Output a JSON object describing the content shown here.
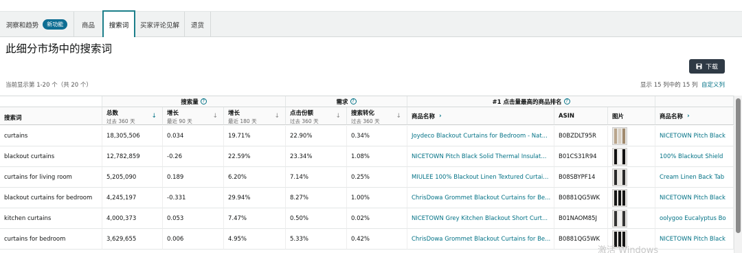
{
  "tabs": [
    {
      "label": "洞察和趋势",
      "badge": "新功能"
    },
    {
      "label": "商品"
    },
    {
      "label": "搜索词"
    },
    {
      "label": "买家评论见解"
    },
    {
      "label": "退货"
    }
  ],
  "page_title": "此细分市场中的搜索词",
  "download_label": "下载",
  "showing_text": "当前显示第 1-20 个（共 20 个）",
  "columns_status": "显示 15 列中的 15 列",
  "customize_label": "自定义列",
  "groups": {
    "search_volume": "搜索量",
    "demand": "需求",
    "top_product": "#1 点击量最高的商品排名"
  },
  "headers": {
    "term": "搜索词",
    "total": {
      "title": "总数",
      "sub": "过去 360 天"
    },
    "growth90": {
      "title": "增长",
      "sub": "最近 90 天"
    },
    "growth180": {
      "title": "增长",
      "sub": "最近 180 天"
    },
    "click_share": {
      "title": "点击份额",
      "sub": "过去 360 天"
    },
    "conversion": {
      "title": "搜索转化",
      "sub": "过去 360 天"
    },
    "product_name": "商品名称",
    "asin": "ASIN",
    "image": "图片",
    "product_name2": "商品名称"
  },
  "rows": [
    {
      "term": "curtains",
      "total": "18,305,506",
      "g90": "0.034",
      "g180": "19.71%",
      "click": "22.90%",
      "conv": "0.34%",
      "product": "Joydeco Blackout Curtains for Bedroom - Nat...",
      "asin": "B0BZDLT95R",
      "product2": "NICETOWN Pitch Black",
      "thumb": [
        "#b9a58c",
        "#d8cfc2",
        "#a08a6e"
      ]
    },
    {
      "term": "blackout curtains",
      "total": "12,782,859",
      "g90": "-0.26",
      "g180": "22.59%",
      "click": "23.34%",
      "conv": "1.08%",
      "product": "NICETOWN Pitch Black Solid Thermal Insulat...",
      "asin": "B01CS31R94",
      "product2": "100% Blackout Shield",
      "thumb": [
        "#111111",
        "#f4f4f4",
        "#111111"
      ]
    },
    {
      "term": "curtains for living room",
      "total": "5,205,090",
      "g90": "0.189",
      "g180": "6.20%",
      "click": "7.14%",
      "conv": "0.25%",
      "product": "MIULEE 100% Blackout Linen Textured Curtai...",
      "asin": "B08SBYPF14",
      "product2": "Cream Linen Back Tab",
      "thumb": [
        "#2a2a2a",
        "#e8e6e2",
        "#2a2a2a"
      ]
    },
    {
      "term": "blackout curtains for bedroom",
      "total": "4,245,197",
      "g90": "-0.331",
      "g180": "29.94%",
      "click": "8.27%",
      "conv": "1.00%",
      "product": "ChrisDowa Grommet Blackout Curtains for Be...",
      "asin": "B0881QG5WK",
      "product2": "NICETOWN Pitch Black",
      "thumb": [
        "#151515",
        "#151515",
        "#151515"
      ]
    },
    {
      "term": "kitchen curtains",
      "total": "4,000,373",
      "g90": "0.053",
      "g180": "7.47%",
      "click": "0.50%",
      "conv": "0.02%",
      "product": "NICETOWN Grey Kitchen Blackout Short Curt...",
      "asin": "B01NAOM85J",
      "product2": "oolygoo Eucalyptus Bo",
      "thumb": [
        "#333333",
        "#f0f0f0",
        "#333333"
      ]
    },
    {
      "term": "curtains for bedroom",
      "total": "3,629,655",
      "g90": "0.006",
      "g180": "4.95%",
      "click": "5.33%",
      "conv": "0.42%",
      "product": "ChrisDowa Grommet Blackout Curtains for Be...",
      "asin": "B0881QG5WK",
      "product2": "NICETOWN Pitch Black",
      "thumb": [
        "#151515",
        "#151515",
        "#151515"
      ]
    }
  ],
  "watermark": "激活 Windows",
  "colors": {
    "accent": "#1b7e8a",
    "link": "#007185",
    "button": "#2f3a45"
  }
}
